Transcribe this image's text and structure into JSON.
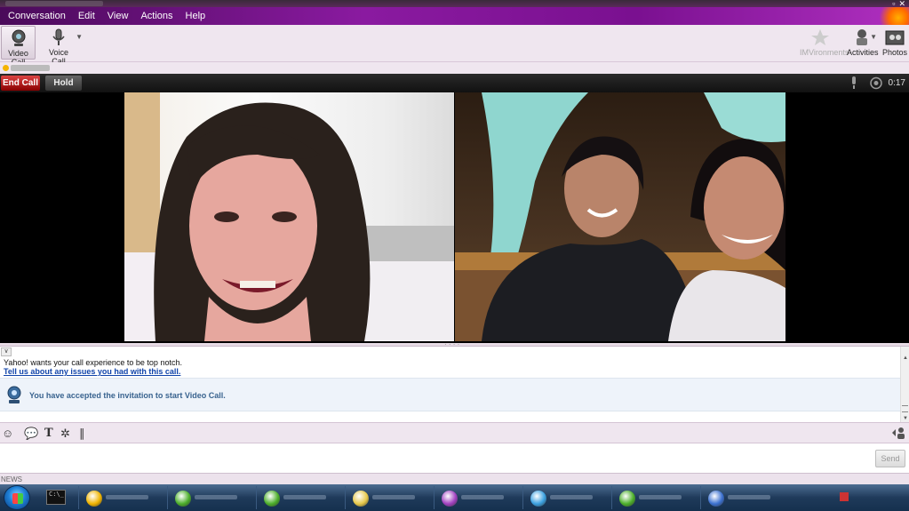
{
  "menu": {
    "items": [
      "Conversation",
      "Edit",
      "View",
      "Actions",
      "Help"
    ]
  },
  "toolbar": {
    "video_call_label": "Video Call",
    "voice_call_label": "Voice Call",
    "imvironments_label": "IMVironments",
    "activities_label": "Activities",
    "photos_label": "Photos"
  },
  "callbar": {
    "end_call_label": "End Call",
    "hold_label": "Hold",
    "timer": "0:17"
  },
  "chat": {
    "notice_text": "Yahoo! wants your call experience to be top notch.",
    "notice_link": "Tell us about any issues you had with this call.",
    "invite_text": "You have accepted the invitation to start Video Call."
  },
  "input": {
    "send_label": "Send"
  },
  "news": {
    "label": "NEWS"
  },
  "taskbar": {
    "items": [
      {
        "color": "#f0b400"
      },
      {
        "color": "#4caf2a"
      },
      {
        "color": "#4caf2a"
      },
      {
        "color": "#e6c84a"
      },
      {
        "color": "#a040c0"
      },
      {
        "color": "#3aa0e0"
      },
      {
        "color": "#4caf2a"
      },
      {
        "color": "#3a70d0"
      }
    ]
  },
  "colors": {
    "menubar_accent": "#8a1aa0",
    "end_call": "#c62828",
    "link": "#1144aa",
    "invite_text": "#39638f"
  }
}
